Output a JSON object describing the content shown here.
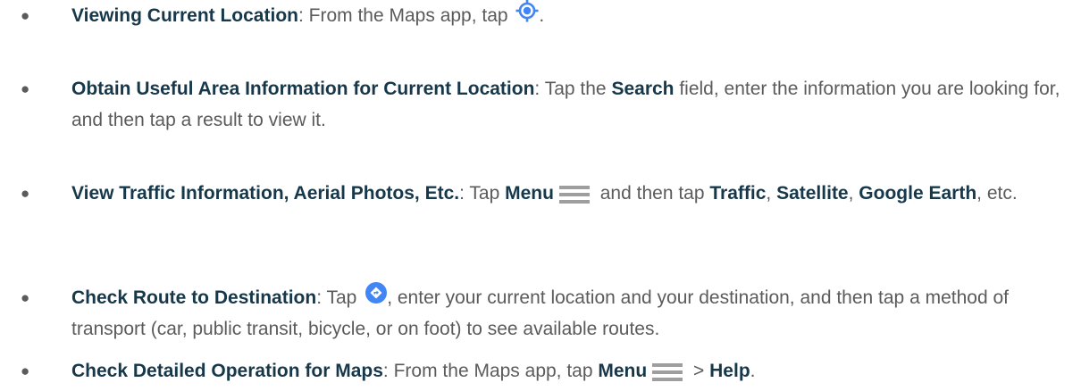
{
  "bullet_char": "●",
  "items": [
    {
      "term": "Viewing Current Location",
      "sep": ":",
      "t1": " From the Maps app, tap ",
      "t2": "."
    },
    {
      "term": "Obtain Useful Area Information for Current Location",
      "sep": ":",
      "t1": " Tap the ",
      "b1": "Search",
      "t2": " field, enter the information you are looking for, and then tap a result to view it."
    },
    {
      "term": "View Traffic Information, Aerial Photos, Etc.",
      "sep": ":",
      "t1": " Tap ",
      "b1": "Menu",
      "t2": " and then tap ",
      "b2": "Traffic",
      "t3": ", ",
      "b3": "Satellite",
      "t4": ", ",
      "b4": "Google Earth",
      "t5": ", etc."
    },
    {
      "term": "Check Route to Destination",
      "sep": ":",
      "t1": " Tap ",
      "t2": ", enter your current location and your destination, and then tap a method of transport (car, public transit, bicycle, or on foot) to see available routes."
    },
    {
      "term": "Check Detailed Operation for Maps",
      "sep": ":",
      "t1": " From the Maps app, tap ",
      "b1": "Menu",
      "t2": " > ",
      "b2": "Help",
      "t3": "."
    }
  ],
  "icons": {
    "current_location": "my-location-icon",
    "menu": "menu-icon",
    "directions": "directions-icon"
  },
  "colors": {
    "term": "#16384a",
    "text": "#5b5b5b",
    "location_blue": "#4285f4",
    "menu_gray": "#9e9e9e"
  }
}
